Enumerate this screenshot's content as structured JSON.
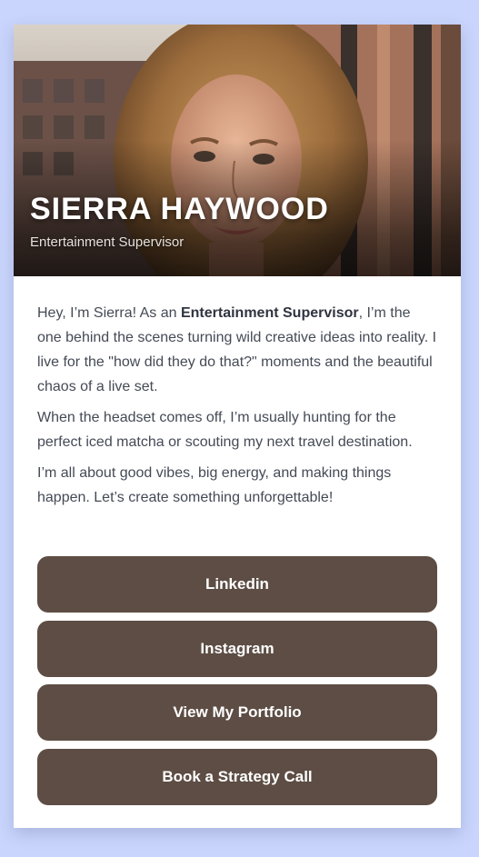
{
  "profile": {
    "name": "SIERRA HAYWOOD",
    "role": "Entertainment Supervisor"
  },
  "bio": {
    "p1_a": "Hey, I’m Sierra! As an ",
    "p1_bold": "Entertainment Supervisor",
    "p1_b": ", I’m the one behind the scenes turning wild creative ideas into reality. I live for the \"how did they do that?\" moments and the beautiful chaos of a live set.",
    "p2": "When the headset comes off, I’m usually hunting for the perfect iced matcha or scouting my next travel destination.",
    "p3": "I’m all about good vibes, big energy, and making things happen. Let’s create something unforgettable!"
  },
  "links": [
    {
      "label": "Linkedin"
    },
    {
      "label": "Instagram"
    },
    {
      "label": "View My Portfolio"
    },
    {
      "label": "Book a Strategy Call"
    }
  ],
  "colors": {
    "page_background": "#c9d5fc",
    "button": "#5d4d44",
    "button_text": "#ffffff",
    "body_text": "#444a55"
  }
}
